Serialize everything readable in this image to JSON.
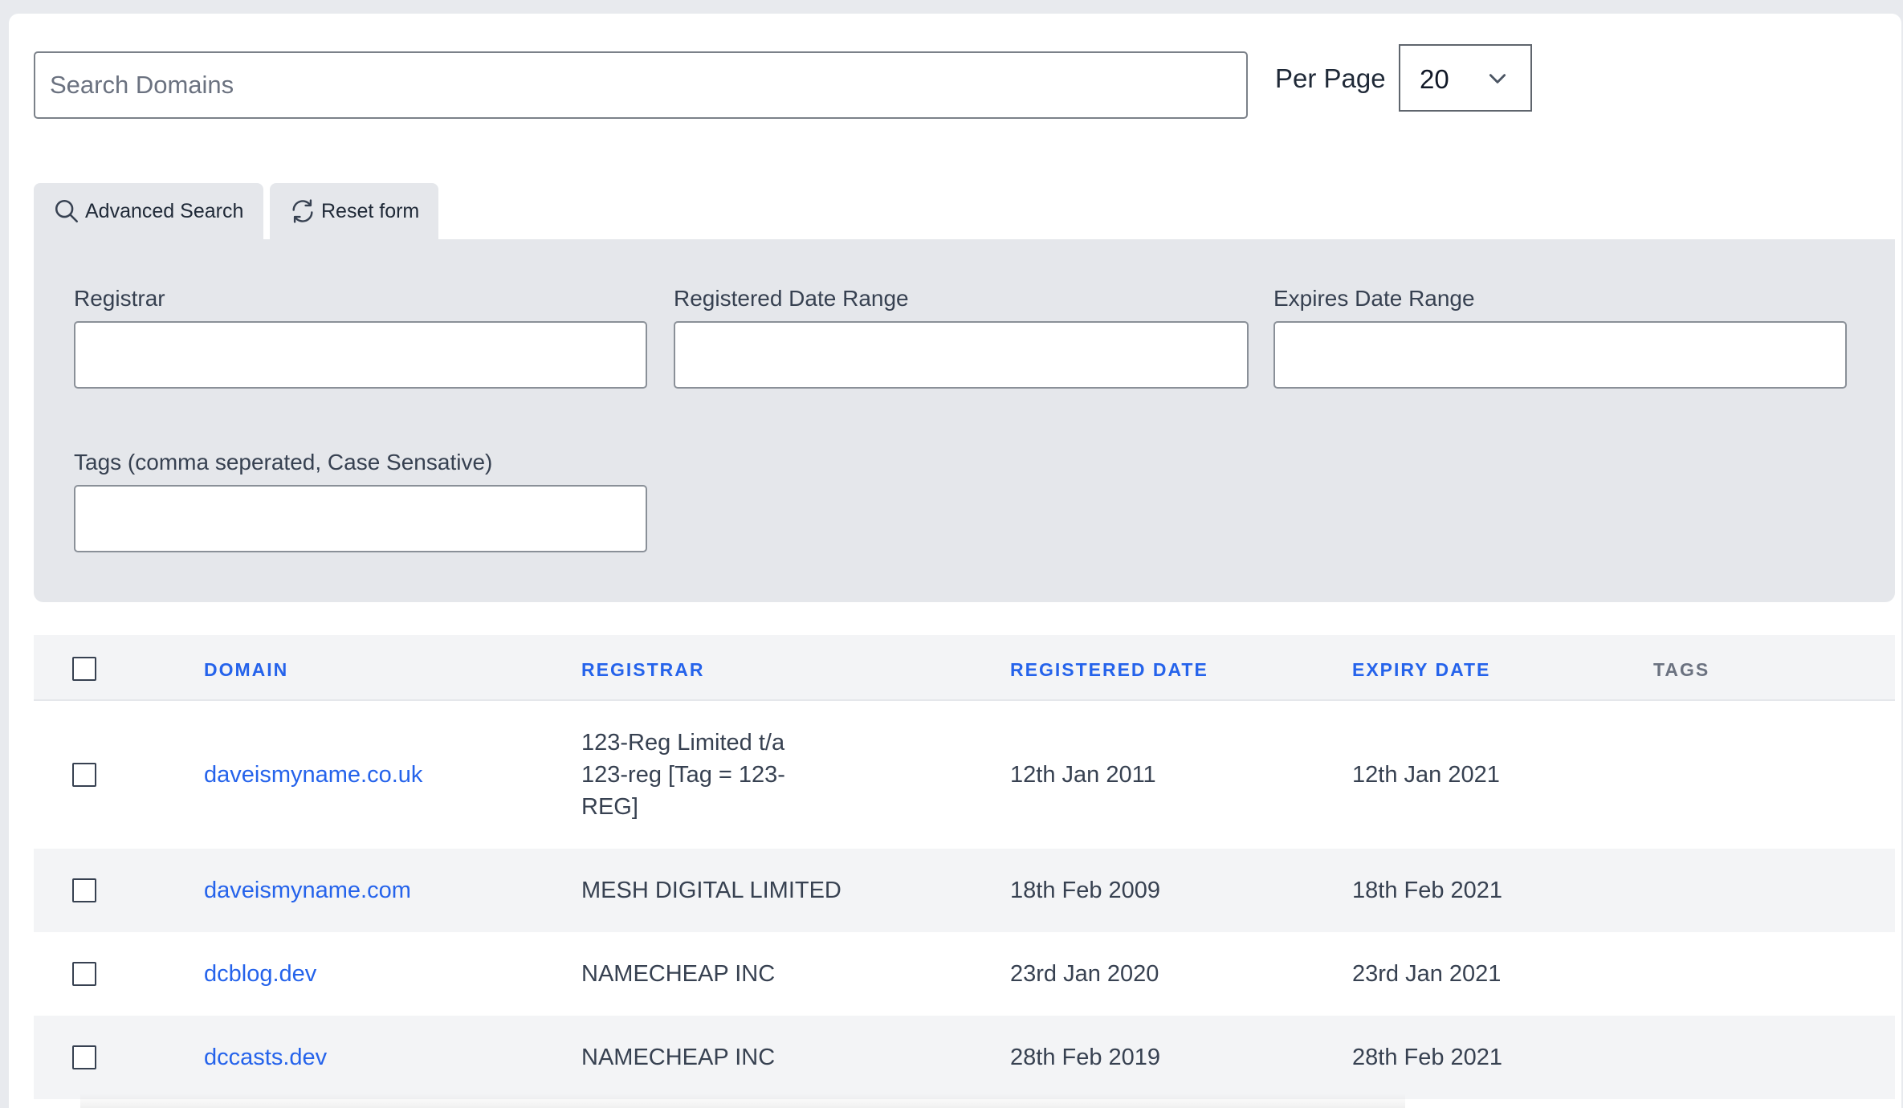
{
  "search": {
    "placeholder": "Search Domains",
    "value": ""
  },
  "per_page": {
    "label": "Per Page",
    "selected": "20"
  },
  "tabs": {
    "advanced_search": "Advanced Search",
    "reset_form": "Reset form"
  },
  "filters": {
    "registrar_label": "Registrar",
    "registered_range_label": "Registered Date Range",
    "expires_range_label": "Expires Date Range",
    "tags_label": "Tags (comma seperated, Case Sensative)"
  },
  "table": {
    "headers": [
      "DOMAIN",
      "REGISTRAR",
      "REGISTERED DATE",
      "EXPIRY DATE",
      "TAGS"
    ],
    "rows": [
      {
        "domain": "daveismyname.co.uk",
        "registrar": [
          "123-Reg Limited t/a",
          "123-reg [Tag = 123-",
          "REG]"
        ],
        "registered": "12th Jan 2011",
        "expiry": "12th Jan 2021",
        "tags": ""
      },
      {
        "domain": "daveismyname.com",
        "registrar": [
          "MESH DIGITAL LIMITED"
        ],
        "registered": "18th Feb 2009",
        "expiry": "18th Feb 2021",
        "tags": ""
      },
      {
        "domain": "dcblog.dev",
        "registrar": [
          "NAMECHEAP INC"
        ],
        "registered": "23rd Jan 2020",
        "expiry": "23rd Jan 2021",
        "tags": ""
      },
      {
        "domain": "dccasts.dev",
        "registrar": [
          "NAMECHEAP INC"
        ],
        "registered": "28th Feb 2019",
        "expiry": "28th Feb 2021",
        "tags": ""
      }
    ]
  },
  "colors": {
    "link": "#2563eb",
    "panel": "#e5e7eb",
    "row_alt": "#f3f4f6"
  },
  "icons": {
    "advanced_search": "search-icon",
    "reset_form": "refresh-icon",
    "per_page": "chevron-down-icon"
  }
}
